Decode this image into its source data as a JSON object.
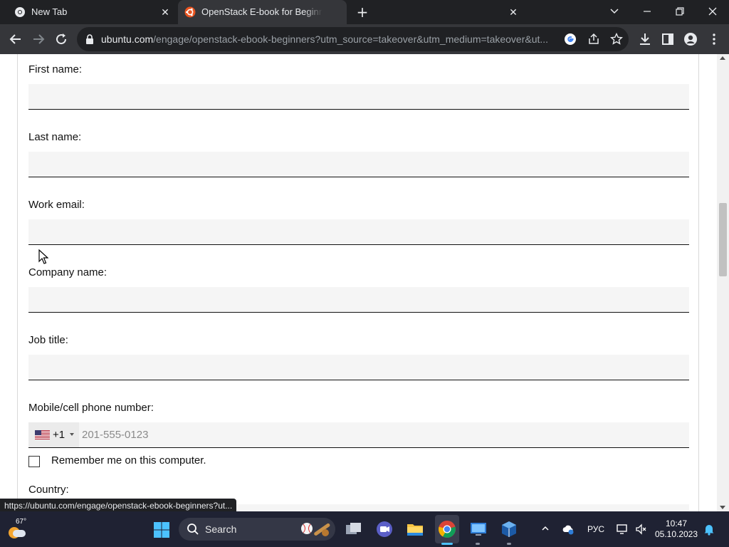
{
  "browser": {
    "tabs": [
      {
        "title": "New Tab",
        "icon": "chrome-icon",
        "active": false
      },
      {
        "title": "OpenStack E-book for Beginners",
        "icon": "ubuntu-icon",
        "active": true
      }
    ],
    "url_host": "ubuntu.com",
    "url_path": "/engage/openstack-ebook-beginners?utm_source=takeover&utm_medium=takeover&ut..."
  },
  "form": {
    "first_name_label": "First name:",
    "last_name_label": "Last name:",
    "work_email_label": "Work email:",
    "company_label": "Company name:",
    "job_title_label": "Job title:",
    "phone_label": "Mobile/cell phone number:",
    "phone_country_code": "+1",
    "phone_placeholder": "201-555-0123",
    "remember_label": "Remember me on this computer.",
    "country_label": "Country:"
  },
  "status_url": "https://ubuntu.com/engage/openstack-ebook-beginners?ut...",
  "taskbar": {
    "temperature": "67°",
    "search_label": "Search",
    "language": "РУС",
    "time": "10:47",
    "date": "05.10.2023"
  },
  "colors": {
    "chrome_dark": "#202124",
    "chrome_toolbar": "#35363a",
    "input_bg": "#f5f5f5",
    "taskbar_bg": "#1f2233",
    "ubuntu_orange": "#e95420"
  }
}
